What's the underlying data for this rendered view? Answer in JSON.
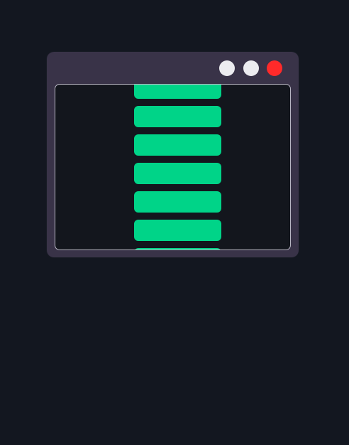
{
  "window": {
    "controls": [
      {
        "name": "minimize",
        "icon": "minimize-icon",
        "color": "#ececf0"
      },
      {
        "name": "maximize",
        "icon": "maximize-icon",
        "color": "#ececf0"
      },
      {
        "name": "close",
        "icon": "close-icon",
        "color": "#ff2a2a"
      }
    ]
  },
  "content": {
    "bars": [
      {
        "color": "#00d488"
      },
      {
        "color": "#00d488"
      },
      {
        "color": "#00d488"
      },
      {
        "color": "#00d488"
      },
      {
        "color": "#00d488"
      },
      {
        "color": "#00d488"
      },
      {
        "color": "#00d488"
      }
    ]
  }
}
